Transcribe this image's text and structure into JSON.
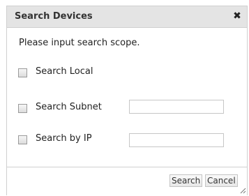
{
  "dialog": {
    "title": "Search Devices",
    "close_glyph": "✖",
    "prompt": "Please input search scope.",
    "options": [
      {
        "label": "Search Local",
        "checked": false
      },
      {
        "label": "Search Subnet",
        "checked": false,
        "input_value": ""
      },
      {
        "label": "Search by IP",
        "checked": false,
        "input_value": ""
      }
    ],
    "buttons": {
      "search": "Search",
      "cancel": "Cancel"
    }
  },
  "icons": {
    "close": "close-icon",
    "checkbox": "checkbox",
    "resize": "resize-grip-icon"
  },
  "colors": {
    "titlebar_bg": "#e4e4e4",
    "border": "#cfcfcf",
    "text": "#222222"
  }
}
